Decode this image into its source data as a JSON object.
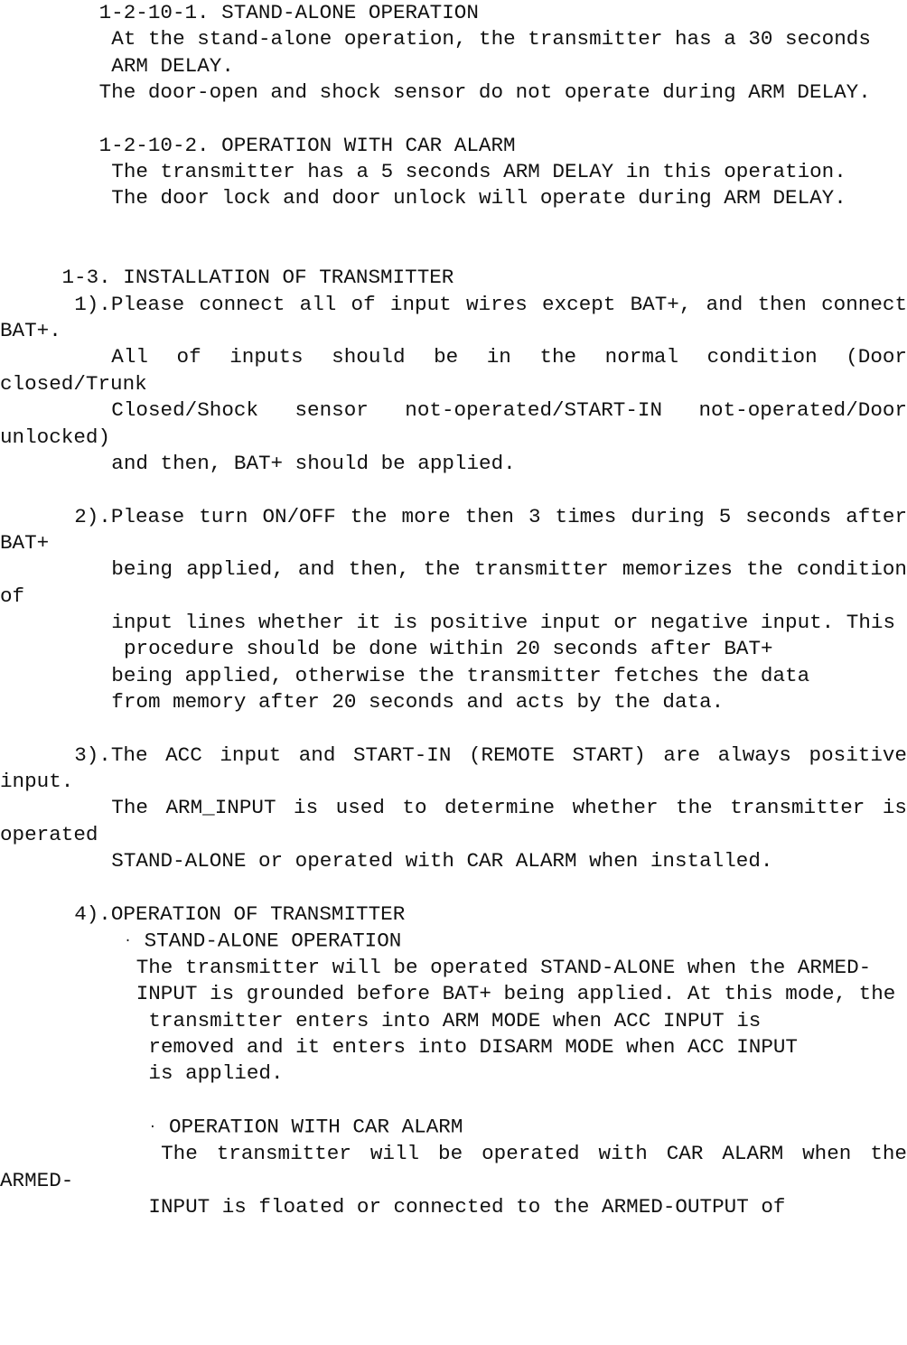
{
  "document": {
    "type": "technical-manual-page",
    "font_style": "monospace",
    "text_color": "#111111",
    "background_color": "#ffffff",
    "blocks": [
      {
        "id": "heading-1-2-10-1",
        "kind": "heading",
        "indent": 8,
        "justify": false,
        "text": "1-2-10-1. STAND-ALONE OPERATION"
      },
      {
        "id": "para-stand-alone-arm-delay",
        "kind": "paragraph",
        "indent": 9,
        "justify": true,
        "text": "At the stand-alone operation, the transmitter has a 30 seconds"
      },
      {
        "id": "para-arm-delay",
        "kind": "paragraph",
        "indent": 9,
        "justify": false,
        "text": "ARM DELAY."
      },
      {
        "id": "para-door-open-shock",
        "kind": "paragraph",
        "indent": 8,
        "justify": true,
        "text": "The door-open and shock sensor do not operate during ARM DELAY."
      },
      {
        "id": "spacer-1",
        "kind": "blank"
      },
      {
        "id": "heading-1-2-10-2",
        "kind": "heading",
        "indent": 8,
        "justify": false,
        "text": "1-2-10-2. OPERATION WITH CAR ALARM"
      },
      {
        "id": "para-car-alarm-arm-delay",
        "kind": "paragraph",
        "indent": 9,
        "justify": true,
        "text": "The transmitter has a 5 seconds ARM DELAY in this operation."
      },
      {
        "id": "para-door-lock-unlock",
        "kind": "paragraph",
        "indent": 9,
        "justify": true,
        "text": "The door lock and door unlock will operate during ARM DELAY."
      },
      {
        "id": "spacer-2",
        "kind": "blank"
      },
      {
        "id": "spacer-3",
        "kind": "blank"
      },
      {
        "id": "heading-1-3",
        "kind": "heading",
        "indent": 5,
        "justify": false,
        "text": "1-3. INSTALLATION OF TRANSMITTER"
      },
      {
        "id": "para-step-1",
        "kind": "paragraph",
        "indent": 6,
        "justify": true,
        "text": "1).Please connect all of input wires except BAT+, and then connect BAT+."
      },
      {
        "id": "para-step-1-normal-condition",
        "kind": "paragraph",
        "indent": 9,
        "justify": true,
        "text": "All of inputs should be in the normal condition (Door closed/Trunk"
      },
      {
        "id": "para-step-1-closed-shock",
        "kind": "paragraph",
        "indent": 9,
        "justify": true,
        "text": "Closed/Shock sensor not-operated/START-IN not-operated/Door unlocked)"
      },
      {
        "id": "para-step-1-and-then",
        "kind": "paragraph",
        "indent": 9,
        "justify": false,
        "text": "and then, BAT+ should be applied."
      },
      {
        "id": "spacer-4",
        "kind": "blank"
      },
      {
        "id": "para-step-2",
        "kind": "paragraph",
        "indent": 6,
        "justify": true,
        "text": "2).Please turn ON/OFF  the more then 3 times during 5 seconds after BAT+"
      },
      {
        "id": "para-step-2-memorizes",
        "kind": "paragraph",
        "indent": 9,
        "justify": true,
        "text": "being applied, and then, the transmitter memorizes the condition of"
      },
      {
        "id": "para-step-2-input-lines",
        "kind": "paragraph",
        "indent": 9,
        "justify": true,
        "text": "input lines whether it is positive input or negative input. This"
      },
      {
        "id": "para-step-2-procedure",
        "kind": "paragraph",
        "indent": 10,
        "justify": true,
        "text": "procedure should be done within 20 seconds after BAT+"
      },
      {
        "id": "para-step-2-being-applied",
        "kind": "paragraph",
        "indent": 9,
        "justify": true,
        "text": "being applied, otherwise the transmitter fetches the data"
      },
      {
        "id": "para-step-2-from-memory",
        "kind": "paragraph",
        "indent": 9,
        "justify": false,
        "text": "from memory after 20 seconds and acts by the data."
      },
      {
        "id": "spacer-5",
        "kind": "blank"
      },
      {
        "id": "para-step-3",
        "kind": "paragraph",
        "indent": 6,
        "justify": true,
        "text": "3).The ACC input and START-IN (REMOTE START) are always positive input."
      },
      {
        "id": "para-step-3-arm-input",
        "kind": "paragraph",
        "indent": 9,
        "justify": true,
        "text": "The ARM_INPUT is used to determine whether the transmitter is operated"
      },
      {
        "id": "para-step-3-stand-alone",
        "kind": "paragraph",
        "indent": 9,
        "justify": false,
        "text": "STAND-ALONE or operated with CAR ALARM when installed."
      },
      {
        "id": "spacer-6",
        "kind": "blank"
      },
      {
        "id": "para-step-4",
        "kind": "heading",
        "indent": 6,
        "justify": false,
        "text": "4).OPERATION OF TRANSMITTER"
      },
      {
        "id": "bullet-stand-alone-operation",
        "kind": "bullet",
        "indent": 10,
        "justify": false,
        "bullet": "·",
        "text": "STAND-ALONE OPERATION"
      },
      {
        "id": "para-bullet1-line1",
        "kind": "paragraph",
        "indent": 11,
        "justify": true,
        "text": "The transmitter will be operated STAND-ALONE when the ARMED-"
      },
      {
        "id": "para-bullet1-line2",
        "kind": "paragraph",
        "indent": 11,
        "justify": true,
        "text": "INPUT is grounded before BAT+ being applied. At this mode, the"
      },
      {
        "id": "para-bullet1-line3",
        "kind": "paragraph",
        "indent": 12,
        "justify": true,
        "text": "transmitter enters into ARM MODE when ACC INPUT is"
      },
      {
        "id": "para-bullet1-line4",
        "kind": "paragraph",
        "indent": 12,
        "justify": true,
        "text": "removed and it enters into DISARM MODE when ACC INPUT"
      },
      {
        "id": "para-bullet1-line5",
        "kind": "paragraph",
        "indent": 12,
        "justify": false,
        "text": "is applied."
      },
      {
        "id": "spacer-7",
        "kind": "blank"
      },
      {
        "id": "bullet-operation-with-car-alarm",
        "kind": "bullet",
        "indent": 12,
        "justify": false,
        "bullet": "·",
        "text": "OPERATION WITH CAR ALARM"
      },
      {
        "id": "para-bullet2-line1",
        "kind": "paragraph",
        "indent": 13,
        "justify": true,
        "text": "The transmitter will be operated with CAR ALARM when the ARMED-"
      },
      {
        "id": "para-bullet2-line2",
        "kind": "paragraph",
        "indent": 12,
        "justify": true,
        "text": "INPUT is floated or connected to the ARMED-OUTPUT of"
      }
    ]
  }
}
